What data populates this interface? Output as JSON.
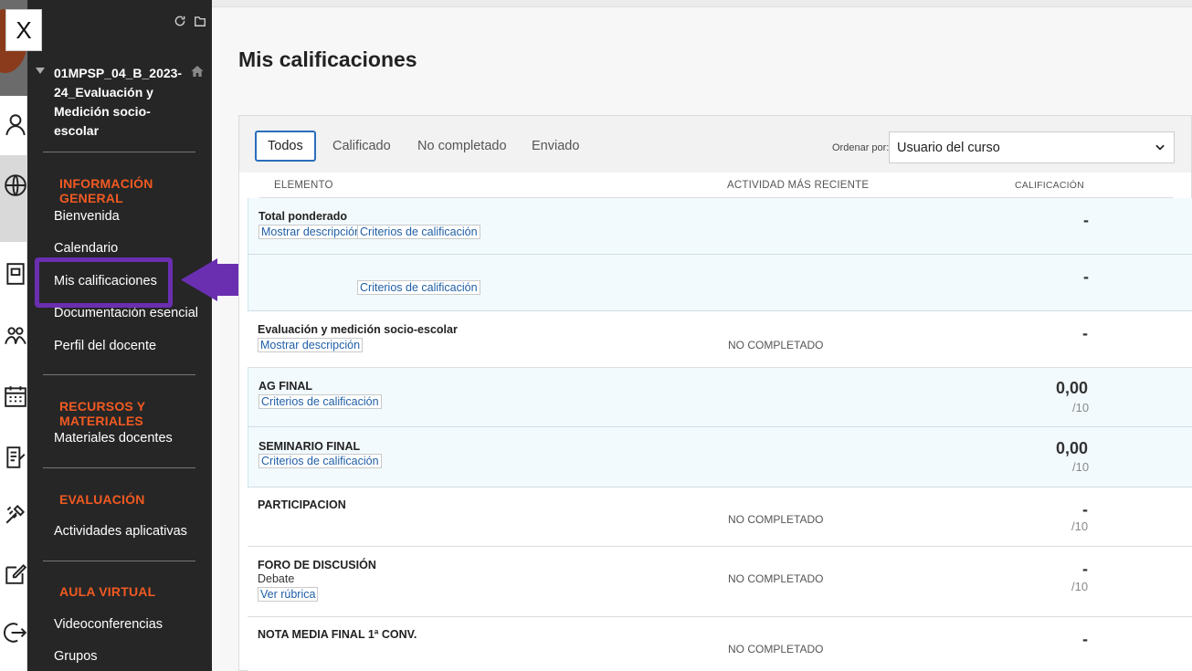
{
  "close_label": "X",
  "course": {
    "title": "01MPSP_04_B_2023-24_Evaluación y Medición socio-escolar"
  },
  "sidebar": {
    "sections": [
      {
        "title": "INFORMACIÓN GENERAL",
        "items": [
          "Bienvenida",
          "Calendario",
          "Mis calificaciones",
          "Documentación esencial",
          "Perfil del docente"
        ]
      },
      {
        "title": "RECURSOS Y MATERIALES",
        "items": [
          "Materiales docentes"
        ]
      },
      {
        "title": "EVALUACIÓN",
        "items": [
          "Actividades aplicativas"
        ]
      },
      {
        "title": "AULA VIRTUAL",
        "items": [
          "Videoconferencias",
          "Grupos"
        ]
      }
    ],
    "highlighted_item": "Mis calificaciones"
  },
  "page": {
    "title": "Mis calificaciones"
  },
  "filters": {
    "tabs": [
      "Todos",
      "Calificado",
      "No completado",
      "Enviado"
    ],
    "active_tab": "Todos",
    "sort_label": "Ordenar por:",
    "sort_value": "Usuario del curso"
  },
  "columns": {
    "item": "ELEMENTO",
    "activity": "ACTIVIDAD MÁS RECIENTE",
    "grade": "CALIFICACIÓN"
  },
  "rows": [
    {
      "title": "Total ponderado",
      "sub": "",
      "links": [
        "Mostrar descripción",
        "Criterios de calificación"
      ],
      "activity": "",
      "grade": "-",
      "outof": ""
    },
    {
      "title": "",
      "sub": "",
      "links": [
        "Criterios de calificación"
      ],
      "activity": "",
      "grade": "-",
      "outof": ""
    },
    {
      "title": "Evaluación y medición socio-escolar",
      "sub": "",
      "links": [
        "Mostrar descripción"
      ],
      "activity": "NO COMPLETADO",
      "grade": "-",
      "outof": ""
    },
    {
      "title": "AG FINAL",
      "sub": "",
      "links": [
        "Criterios de calificación"
      ],
      "activity": "",
      "grade": "0,00",
      "outof": "/10"
    },
    {
      "title": "SEMINARIO FINAL",
      "sub": "",
      "links": [
        "Criterios de calificación"
      ],
      "activity": "",
      "grade": "0,00",
      "outof": "/10"
    },
    {
      "title": "PARTICIPACION",
      "sub": "",
      "links": [],
      "activity": "NO COMPLETADO",
      "grade": "-",
      "outof": "/10"
    },
    {
      "title": "FORO DE DISCUSIÓN",
      "sub": "Debate",
      "links": [
        "Ver rúbrica"
      ],
      "activity": "NO COMPLETADO",
      "grade": "-",
      "outof": "/10"
    },
    {
      "title": "NOTA MEDIA FINAL 1ª CONV.",
      "sub": "",
      "links": [],
      "activity": "NO COMPLETADO",
      "grade": "-",
      "outof": ""
    }
  ],
  "colors": {
    "accent": "#f15a22",
    "highlight": "#6a2fb0",
    "link": "#1f5fa6"
  },
  "icons": [
    "user-icon",
    "globe-icon",
    "book-icon",
    "people-icon",
    "calendar-icon",
    "document-icon",
    "tools-icon",
    "edit-icon",
    "logout-icon",
    "refresh-icon",
    "folder-icon",
    "home-icon",
    "chevron-down-icon"
  ]
}
